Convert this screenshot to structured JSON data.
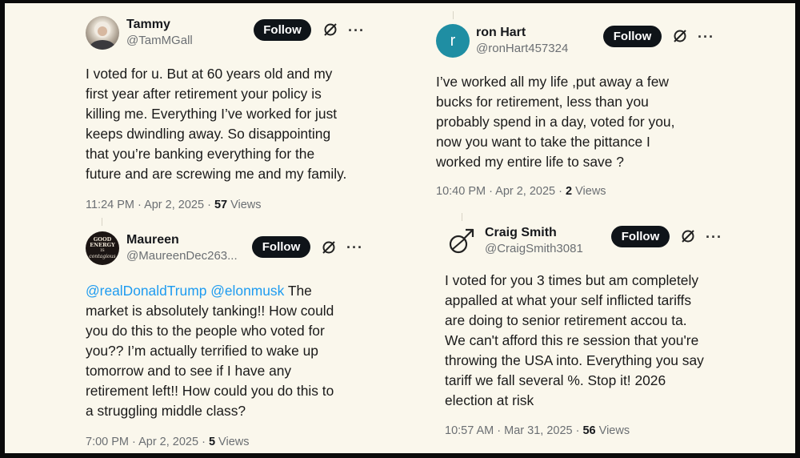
{
  "tweets": [
    {
      "name": "Tammy",
      "handle": "@TamMGall",
      "follow_label": "Follow",
      "more_label": "···",
      "avatar_icon": "profile-photo",
      "body": "I voted for u.  But at 60 years old and my\nfirst year after retirement your policy is\nkilling me. Everything I’ve worked for just\nkeeps dwindling away. So disappointing\nthat you’re banking everything for the\nfuture and are screwing me and my family.",
      "time": "11:24 PM · Apr 2, 2025 · ",
      "views_count": "57",
      "views_label": " Views"
    },
    {
      "name": "Maureen",
      "handle": "@MaureenDec263...",
      "follow_label": "Follow",
      "more_label": "···",
      "avatar_icon": "good-energy-badge",
      "avatar_text": [
        "GOOD",
        "ENERGY",
        "IS",
        "contagious"
      ],
      "mentions": [
        "@realDonaldTrump",
        "@elonmusk"
      ],
      "body": " The\nmarket is absolutely tanking!! How could\nyou do this to the people who voted for\nyou?? I’m actually terrified to wake up\ntomorrow and to see if I have any\nretirement left!!  How could you do this to\na struggling middle class?",
      "time": "7:00 PM · Apr 2, 2025 · ",
      "views_count": "5",
      "views_label": " Views"
    },
    {
      "name": "ron Hart",
      "handle": "@ronHart457324",
      "follow_label": "Follow",
      "more_label": "···",
      "avatar_letter": "r",
      "avatar_color": "#1f8ea3",
      "body": "I’ve worked all my life ,put away a few\nbucks  for retirement, less than you\nprobably spend in a day, voted for you,\nnow you want to take the pittance I\nworked my entire life to save ?",
      "time": "10:40 PM · Apr 2, 2025 · ",
      "views_count": "2",
      "views_label": " Views"
    },
    {
      "name": "Craig Smith",
      "handle": "@CraigSmith3081",
      "follow_label": "Follow",
      "more_label": "···",
      "avatar_icon": "mars-symbol-icon",
      "body": "I voted for you 3 times but am completely\nappalled at what your self inflicted tariffs\nare doing to senior retirement accou ta.\nWe can't afford this re session that you're\nthrowing the USA into.   Everything you say\ntariff we fall several %.   Stop it!   2026\nelection at risk",
      "time": "10:57 AM · Mar 31, 2025 · ",
      "views_count": "56",
      "views_label": " Views"
    }
  ]
}
